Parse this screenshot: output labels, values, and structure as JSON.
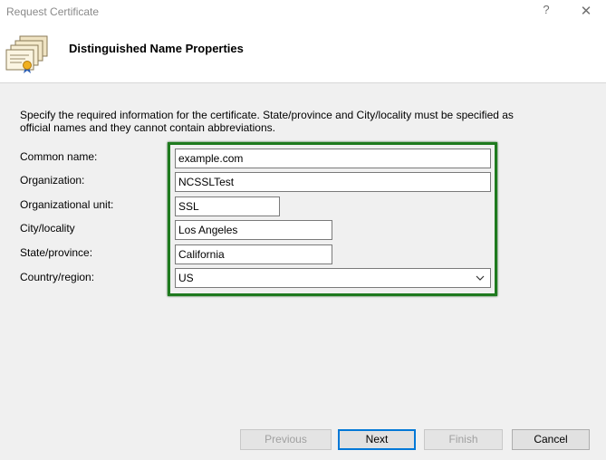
{
  "window": {
    "title": "Request Certificate",
    "help_glyph": "?",
    "close_glyph": "✕"
  },
  "header": {
    "title": "Distinguished Name Properties",
    "icon": "certificate-icon"
  },
  "instructions": "Specify the required information for the certificate. State/province and City/locality must be specified as official names and they cannot contain abbreviations.",
  "form": {
    "common_name": {
      "label": "Common name:",
      "value": "example.com"
    },
    "organization": {
      "label": "Organization:",
      "value": "NCSSLTest"
    },
    "organizational_unit": {
      "label": "Organizational unit:",
      "value": "SSL"
    },
    "city": {
      "label": "City/locality",
      "value": "Los Angeles"
    },
    "state": {
      "label": "State/province:",
      "value": "California"
    },
    "country": {
      "label": "Country/region:",
      "value": "US"
    }
  },
  "highlight_color": "#1e7a1e",
  "buttons": {
    "previous": "Previous",
    "next": "Next",
    "finish": "Finish",
    "cancel": "Cancel"
  }
}
